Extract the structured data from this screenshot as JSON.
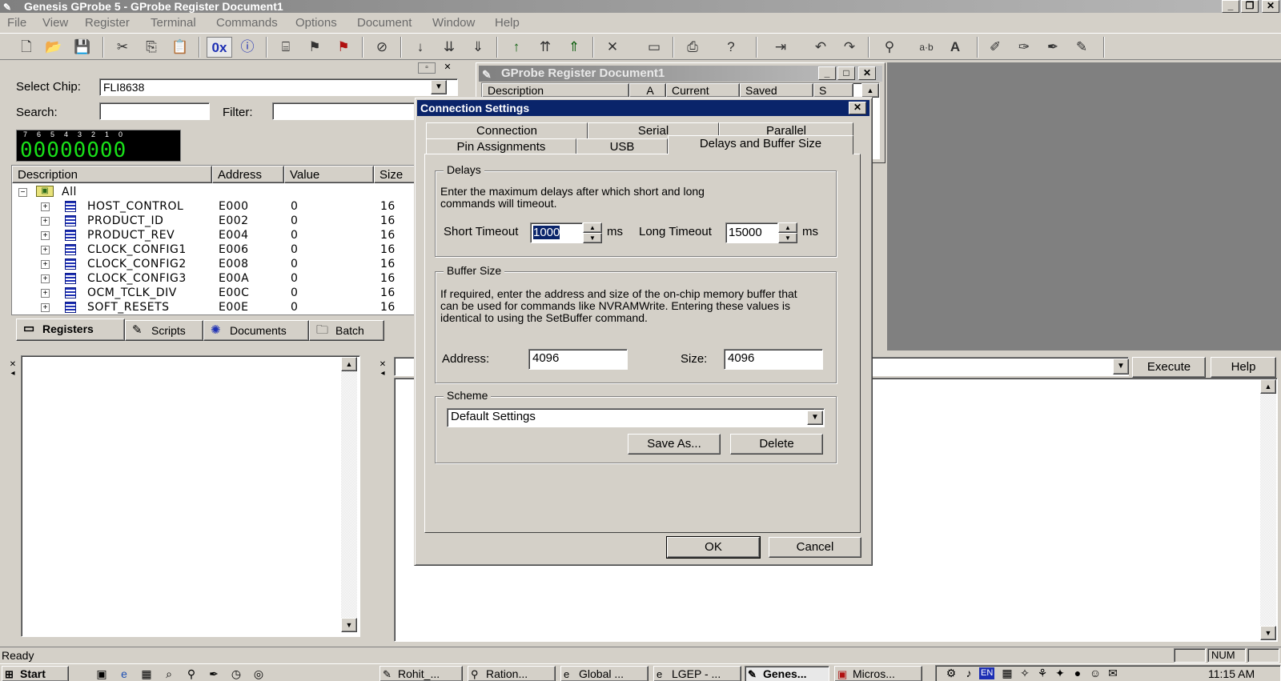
{
  "window": {
    "title": "Genesis GProbe 5 - GProbe Register Document1",
    "min": "_",
    "max": "❐",
    "close": "✕"
  },
  "menu": [
    "File",
    "View",
    "Register",
    "Terminal",
    "Commands",
    "Options",
    "Document",
    "Window",
    "Help"
  ],
  "toolbar": {
    "hex_label": "0x"
  },
  "left_pane": {
    "select_chip_label": "Select Chip:",
    "select_chip_value": "FLI8638",
    "search_label": "Search:",
    "search_value": "",
    "filter_label": "Filter:",
    "filter_value": "",
    "bit_labels": "76543210",
    "bit_value": "00000000",
    "columns": [
      "Description",
      "Address",
      "Value",
      "Size"
    ],
    "root_label": "All",
    "rows": [
      {
        "name": "HOST_CONTROL",
        "address": "E000",
        "value": "0",
        "size": "16"
      },
      {
        "name": "PRODUCT_ID",
        "address": "E002",
        "value": "0",
        "size": "16"
      },
      {
        "name": "PRODUCT_REV",
        "address": "E004",
        "value": "0",
        "size": "16"
      },
      {
        "name": "CLOCK_CONFIG1",
        "address": "E006",
        "value": "0",
        "size": "16"
      },
      {
        "name": "CLOCK_CONFIG2",
        "address": "E008",
        "value": "0",
        "size": "16"
      },
      {
        "name": "CLOCK_CONFIG3",
        "address": "E00A",
        "value": "0",
        "size": "16"
      },
      {
        "name": "OCM_TCLK_DIV",
        "address": "E00C",
        "value": "0",
        "size": "16"
      },
      {
        "name": "SOFT_RESETS",
        "address": "E00E",
        "value": "0",
        "size": "16"
      }
    ],
    "tabs": [
      "Registers",
      "Scripts",
      "Documents",
      "Batch"
    ]
  },
  "doc_window": {
    "title": "GProbe Register Document1",
    "columns": [
      "Description",
      "A",
      "Current",
      "Saved",
      "S"
    ]
  },
  "command_bar": {
    "execute_label": "Execute",
    "help_label": "Help"
  },
  "dialog": {
    "title": "Connection Settings",
    "close": "✕",
    "tabs_back": [
      "Connection",
      "Serial",
      "Parallel"
    ],
    "tabs_front": [
      "Pin Assignments",
      "USB",
      "Delays and Buffer Size"
    ],
    "delays": {
      "legend": "Delays",
      "desc": "Enter the maximum delays after which short and long commands will timeout.",
      "short_label": "Short Timeout",
      "short_value": "1000",
      "short_unit": "ms",
      "long_label": "Long Timeout",
      "long_value": "15000",
      "long_unit": "ms"
    },
    "buffer": {
      "legend": "Buffer Size",
      "desc": "If required, enter the address and size of the on-chip memory buffer that can be used for commands like NVRAMWrite. Entering these values is identical to using the SetBuffer command.",
      "address_label": "Address:",
      "address_value": "4096",
      "size_label": "Size:",
      "size_value": "4096"
    },
    "scheme": {
      "legend": "Scheme",
      "selected": "Default Settings",
      "save_as": "Save As...",
      "delete": "Delete"
    },
    "ok": "OK",
    "cancel": "Cancel"
  },
  "status": {
    "text": "Ready",
    "num": "NUM"
  },
  "taskbar": {
    "start": "Start",
    "tasks": [
      "Rohit_...",
      "Ration...",
      "Global ...",
      "LGEP - ...",
      "Genes...",
      "Micros..."
    ],
    "clock": "11:15 AM",
    "lang": "EN"
  },
  "colors": {
    "dialog_title": "#0a246a",
    "bit_display": "#19e019",
    "workspace": "#808080"
  }
}
